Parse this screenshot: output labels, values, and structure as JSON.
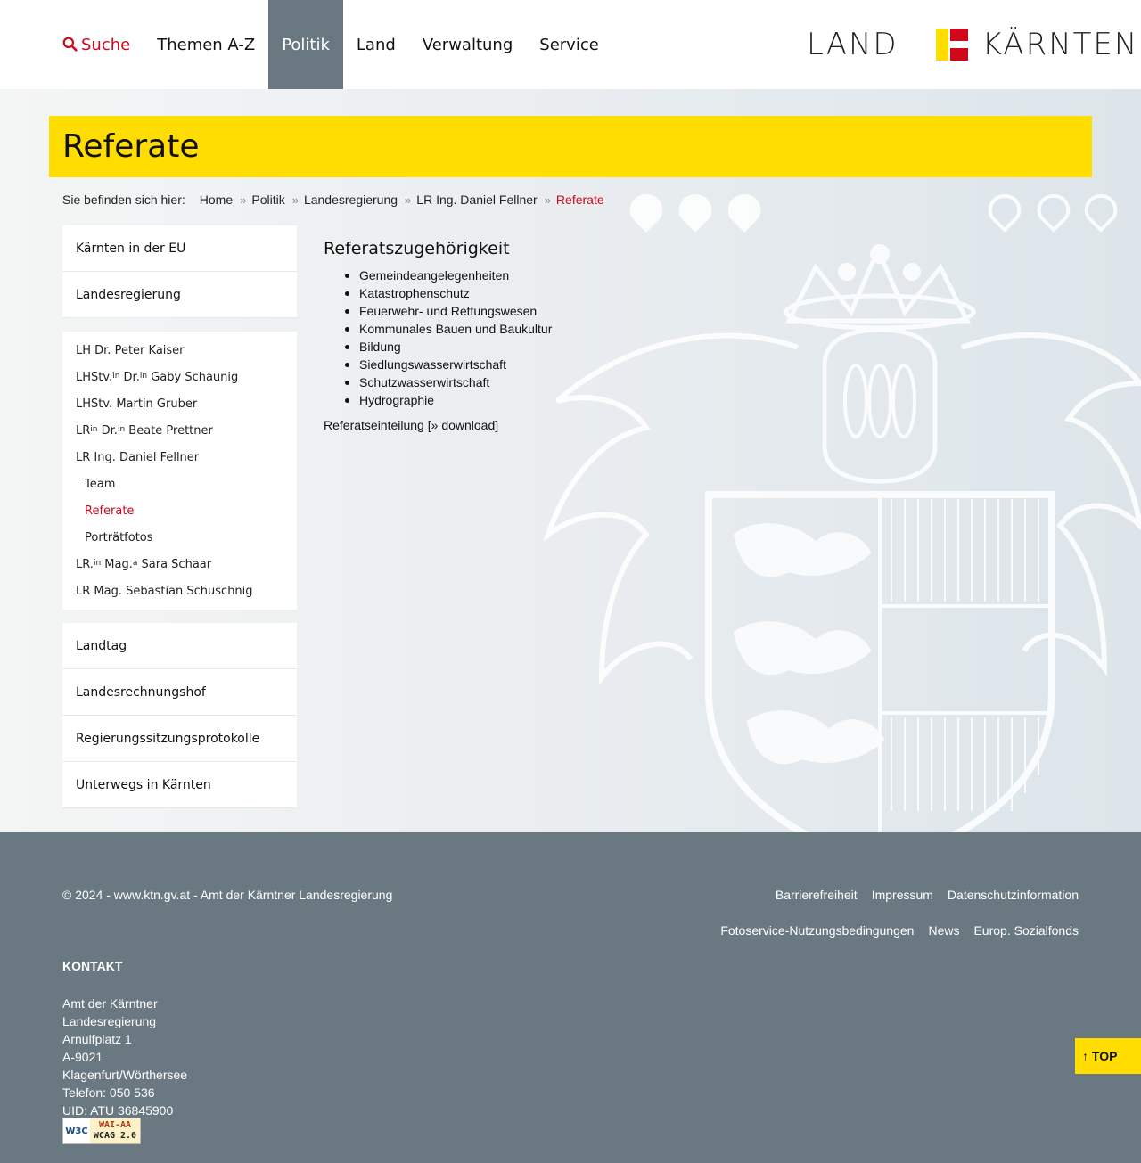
{
  "header": {
    "search_label": "Suche",
    "nav": [
      "Themen A-Z",
      "Politik",
      "Land",
      "Verwaltung",
      "Service"
    ],
    "active_nav": "Politik",
    "logo_left": "LAND",
    "logo_right": "KÄRNTEN",
    "logo_colors": {
      "yellow": "#ffdd00",
      "red": "#d0081a"
    }
  },
  "page": {
    "title": "Referate"
  },
  "breadcrumb": {
    "prefix": "Sie befinden sich hier:",
    "items": [
      "Home",
      "Politik",
      "Landesregierung",
      "LR Ing. Daniel Fellner",
      "Referate"
    ]
  },
  "sidebar": {
    "top_items": [
      "Kärnten in der EU",
      "Landesregierung"
    ],
    "sub_items": {
      "kaiser": "LH Dr. Peter Kaiser",
      "schaunig_a": "LHStv.",
      "schaunig_sup1": "in",
      "schaunig_b": " Dr.",
      "schaunig_sup2": "in",
      "schaunig_c": " Gaby Schaunig",
      "gruber": "LHStv. Martin Gruber",
      "prettner_a": "LR",
      "prettner_sup1": "in",
      "prettner_b": " Dr.",
      "prettner_sup2": "in",
      "prettner_c": " Beate Prettner",
      "fellner": "LR Ing. Daniel Fellner",
      "team": "Team",
      "referate": "Referate",
      "portraet": "Porträtfotos",
      "schaar_a": "LR.",
      "schaar_sup1": "in",
      "schaar_b": " Mag.",
      "schaar_sup2": "a",
      "schaar_c": " Sara Schaar",
      "schuschnig": "LR Mag. Sebastian Schuschnig"
    },
    "bottom_items": [
      "Landtag",
      "Landesrechnungshof",
      "Regierungssitzungsprotokolle",
      "Unterwegs in Kärnten"
    ]
  },
  "content": {
    "heading": "Referatszugehörigkeit",
    "list": [
      "Gemeindeangelegenheiten",
      "Katastrophenschutz",
      "Feuerwehr- und Rettungswesen",
      "Kommunales Bauen und Baukultur",
      "Bildung",
      "Siedlungswasserwirtschaft",
      "Schutzwasserwirtschaft",
      "Hydrographie"
    ],
    "download_text": "Referatseinteilung [",
    "download_link": "» download",
    "download_close": "]"
  },
  "footer": {
    "copyright": "© 2024 - www.ktn.gv.at - Amt der Kärntner Landesregierung",
    "links_row1": [
      "Barrierefreiheit",
      "Impressum",
      "Datenschutzinformation"
    ],
    "links_row2": [
      "Fotoservice-Nutzungsbedingungen",
      "News",
      "Europ. Sozialfonds"
    ],
    "kontakt_heading": "KONTAKT",
    "kontakt_lines": [
      "Amt der Kärntner",
      "Landesregierung",
      "Arnulfplatz 1",
      "A-9021",
      "Klagenfurt/Wörthersee",
      "Telefon: 050 536",
      "UID: ATU 36845900"
    ],
    "wcag_w3c": "W3C",
    "wcag_line1": "WAI-AA",
    "wcag_line2": "WCAG 2.0"
  },
  "top_button": "↑ TOP"
}
